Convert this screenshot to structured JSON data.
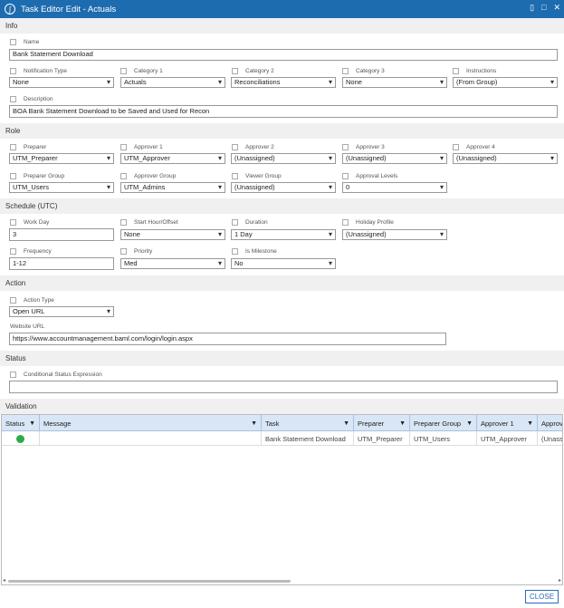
{
  "window": {
    "title": "Task Editor Edit - Actuals"
  },
  "sections": {
    "info": "Info",
    "role": "Role",
    "schedule": "Schedule (UTC)",
    "action": "Action",
    "status": "Status",
    "validation": "Validation"
  },
  "info": {
    "name_label": "Name",
    "name_value": "Bank Statement Download",
    "notification_type_label": "Notification Type",
    "notification_type_value": "None",
    "category1_label": "Category 1",
    "category1_value": "Actuals",
    "category2_label": "Category 2",
    "category2_value": "Reconciliations",
    "category3_label": "Category 3",
    "category3_value": "None",
    "instructions_label": "Instructions",
    "instructions_value": "(From Group)",
    "description_label": "Description",
    "description_value": "BOA Bank Statement Download to be Saved and Used for Recon"
  },
  "role": {
    "preparer_label": "Preparer",
    "preparer_value": "UTM_Preparer",
    "approver1_label": "Approver 1",
    "approver1_value": "UTM_Approver",
    "approver2_label": "Approver 2",
    "approver2_value": "(Unassigned)",
    "approver3_label": "Approver 3",
    "approver3_value": "(Unassigned)",
    "approver4_label": "Approver 4",
    "approver4_value": "(Unassigned)",
    "preparer_group_label": "Preparer Group",
    "preparer_group_value": "UTM_Users",
    "approver_group_label": "Approver Group",
    "approver_group_value": "UTM_Admins",
    "viewer_group_label": "Viewer Group",
    "viewer_group_value": "(Unassigned)",
    "approval_levels_label": "Approval Levels",
    "approval_levels_value": "0"
  },
  "schedule": {
    "work_day_label": "Work Day",
    "work_day_value": "3",
    "start_hour_label": "Start Hour/Offset",
    "start_hour_value": "None",
    "duration_label": "Duration",
    "duration_value": "1 Day",
    "holiday_profile_label": "Holiday Profile",
    "holiday_profile_value": "(Unassigned)",
    "frequency_label": "Frequency",
    "frequency_value": "1-12",
    "priority_label": "Priority",
    "priority_value": "Med",
    "is_milestone_label": "Is Milestone",
    "is_milestone_value": "No"
  },
  "action": {
    "action_type_label": "Action Type",
    "action_type_value": "Open URL",
    "website_url_label": "Website URL",
    "website_url_value": "https://www.accountmanagement.baml.com/login/login.aspx"
  },
  "status": {
    "conditional_label": "Conditional Status Expression",
    "conditional_value": ""
  },
  "validation": {
    "columns": [
      "Status",
      "Message",
      "Task",
      "Preparer",
      "Preparer Group",
      "Approver 1",
      "Approv"
    ],
    "rows": [
      {
        "status_color": "#2eaa4a",
        "message": "",
        "task": "Bank Statement Download",
        "preparer": "UTM_Preparer",
        "preparer_group": "UTM_Users",
        "approver1": "UTM_Approver",
        "approver_next": "(Unass"
      }
    ]
  },
  "footer": {
    "close_label": "CLOSE"
  },
  "icons": {
    "logo": "app-logo-icon",
    "restore": "restore-icon",
    "maximize": "maximize-icon",
    "close": "close-icon",
    "filter": "filter-icon"
  }
}
